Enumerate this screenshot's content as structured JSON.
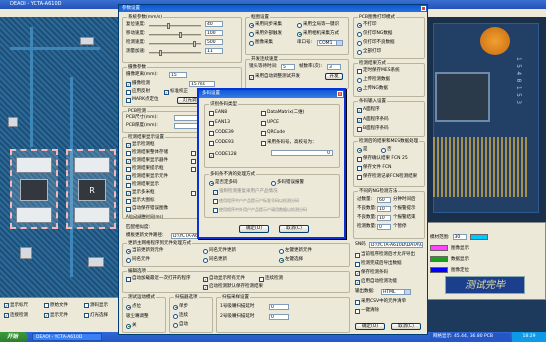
{
  "app": {
    "title": "DEAOI - YCTA-A610D",
    "pcb_chip_label": "R"
  },
  "settings_window": {
    "title": "参数设置",
    "left": {
      "system_group": "系统参数(mm/s)",
      "speed_rows": [
        {
          "label": "复位速度:",
          "value": "40"
        },
        {
          "label": "移动速度:",
          "value": "100"
        },
        {
          "label": "检测速度:",
          "value": "500"
        },
        {
          "label": "测量加速:",
          "value": "11"
        }
      ],
      "scan_group": "摄像参数",
      "scan_distance_label": "摄像距离(mm):",
      "scan_distance_value": "15",
      "scan_mode_label": "摄像检测",
      "scan_mode_value": "15 ms",
      "chk_reflect": "应用反射",
      "chk_calib": "标准校正",
      "chk_mark_pos": "MARK点定位",
      "btn_light": "灯光调整",
      "pcb_group": "PCB检测",
      "pcb_rows": [
        {
          "label": "PCB尺寸(mm):",
          "value": ""
        },
        {
          "label": "PCB厚度(mm):",
          "value": ""
        }
      ],
      "display_group": "检测结果显示设置",
      "display_checks": [
        "显示检测框",
        "检测结果整体存储",
        "检测结果显示器件",
        "检测结果提示框",
        "检测结果显示元件",
        "检测结果显示",
        "显示多米框",
        "显示大图标",
        "自动保存错误图像"
      ],
      "display_side": [
        "显示步骤",
        "不良显示",
        "标记检测",
        "显示图表"
      ],
      "ai_label": "AI自动调整时间(ms)",
      "ai_value": "20",
      "match_label": "匹配相似度:",
      "template_label": "模板更新文件路径:",
      "template_value": "D:\\YCTA-A610D",
      "template_btn": "浏览",
      "update_group": "更新主网格程序到元件处理方式",
      "update_radios": [
        "当前更新到元件",
        "同名元件更新",
        "同名元件",
        "左键更新元件",
        "同名更新",
        "左键选择"
      ],
      "compile_group": "编辑选项",
      "compile_checks": [
        "自动加载最近一次打开的程序",
        "自动显示所有元件",
        "启动检测默认保存检测结果"
      ],
      "compile_side": [
        "调试选项",
        "连续检测"
      ],
      "bottom_rows": [
        {
          "label": "测试运动模式",
          "value": "点位"
        },
        {
          "label": "吸尘嘴调整",
          "value": "关"
        }
      ],
      "scan_method_group": "扫描器选项",
      "scan_method_radios": [
        "单步",
        "连续",
        "自动"
      ],
      "sample_label": "扫描采样设置",
      "sample_rows": [
        {
          "label": "1号吸嘴扫描延时",
          "value": "0"
        },
        {
          "label": "2号吸嘴扫描延时",
          "value": "0"
        }
      ]
    },
    "middle": {
      "frame_group": "框图设置",
      "frame_radios": [
        "采用同步采集",
        "采用外部触发",
        "图像采集"
      ],
      "frame_right_radios": [
        "采用全局等一键识",
        "采用相机采集方式",
        "串口号:"
      ],
      "com_value": "COM1",
      "continuous_group": "开发连续速度",
      "cont_rows": [
        {
          "label": "镜头等待时间:",
          "value": "5"
        },
        {
          "label": "帧数率(次):",
          "value": "3"
        }
      ],
      "cont_check": "采用自动调整测试开发",
      "cont_side": "开发",
      "result_label": "模板检测结果统计"
    },
    "right": {
      "pcb_group": "PCB图像打印模式",
      "pcb_radios": [
        "不打印",
        "仅打印NG数据",
        "仅打印不良数据",
        "全部打印"
      ],
      "mode_group": "检测结果方式",
      "mode_checks": [
        "定时保存MES系统"
      ],
      "mode_radios": [
        "上传检测数据",
        "上传NG数据"
      ],
      "mode_btn": "MES",
      "bar_group": "条码输入设置",
      "bar_checks": [
        "A面程序",
        "A面程序条码",
        "B面程序条码"
      ],
      "bar2_group": "检测后的结果和MES数据处理",
      "bar2_radio_on": "是",
      "bar2_radio_off": "否",
      "bar2_checks": [
        "保存确认结果 FCN 25",
        "保存文件 FCN",
        "保存检测记录FCN检测结果"
      ],
      "ng_group": "不同的NG检测方法",
      "ng_rows": [
        {
          "label": "过数量:",
          "value": "60",
          "unit": "分钟时间后"
        },
        {
          "label": "不良数量:",
          "value": "10",
          "unit": "个报警提示"
        },
        {
          "label": "不良数量:",
          "value": "10",
          "unit": "个报警结束"
        },
        {
          "label": "检测数量:",
          "value": "0",
          "unit": "个暂停"
        }
      ],
      "ng_checks": [
        "连续报警",
        "检测暂停"
      ],
      "sn_label": "SN码",
      "sn_value": "D:\\YCTA-A610D\\DATA\\CSV",
      "export_checks": [
        "当前程序检测后才允许导出",
        "检测完成后导出数据",
        "保存检测条码",
        "启用自动检测功能"
      ],
      "output_label": "输出数据:",
      "output_value": "HTML",
      "final_checks": [
        "采用CSV中的元件清单",
        "一键清除"
      ],
      "ok_btn": "确定(O)",
      "cancel_btn": "取消(C)"
    }
  },
  "modal": {
    "title": "多码设置",
    "recognize_group": "识别条码类型",
    "options": [
      {
        "label": "EAN8",
        "checked": false
      },
      {
        "label": "DataMatrix(二维)",
        "checked": false
      },
      {
        "label": "EAN13",
        "checked": false
      },
      {
        "label": "UPCE",
        "checked": false
      },
      {
        "label": "CODE39",
        "checked": false
      },
      {
        "label": "QRCode",
        "checked": false
      },
      {
        "label": "CODE93",
        "checked": false
      },
      {
        "label": "采用条码号，高校号为：",
        "checked": false
      },
      {
        "label": "CODE128",
        "checked": true
      }
    ],
    "code_length_value": "0",
    "mode_group": "多码条不清的处理方式",
    "mode_radios": [
      {
        "label": "是否定多码",
        "on": true
      },
      {
        "label": "多码错误报警",
        "on": false
      }
    ],
    "mode_checks": [
      "强制检测重复采用户产品情况",
      "使用程序中户产品提示户标准号码以检测分码",
      "使用程序中外用户产品提示户请用数据以检测分码"
    ],
    "ok_btn": "确定(O)",
    "cancel_btn": "取消(C)"
  },
  "right_panel": {
    "rows": [
      {
        "label": "模材范围:",
        "value": "30",
        "color": "#00c8ff"
      },
      {
        "label": "图像显示",
        "value": "",
        "color": "#ff40ff"
      },
      {
        "label": "",
        "value": "",
        "color": "#1aa31a"
      },
      {
        "label": "图像定位",
        "value": "",
        "color": "#0000ff"
      }
    ],
    "checks": [
      "数据显示",
      "图像元件",
      "重复元件"
    ],
    "banner": "测试完毕"
  },
  "bottom_left": {
    "checks": [
      {
        "label": "显示标尺",
        "checked": true
      },
      {
        "label": "原始文件",
        "checked": false
      },
      {
        "label": "源码显示",
        "checked": false
      },
      {
        "label": "连接检测",
        "checked": true
      },
      {
        "label": "显示元件",
        "checked": true
      },
      {
        "label": "灯光选择",
        "checked": false
      }
    ]
  },
  "taskbar": {
    "start": "开始",
    "items": [
      "DEAOI - YCTA-A610D"
    ],
    "clock": "18:29",
    "status": "网格显示: 45.44, 36.80 PCB"
  }
}
